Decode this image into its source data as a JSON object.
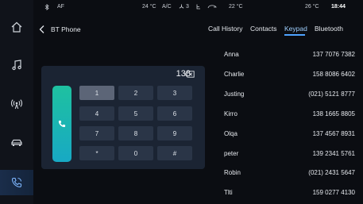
{
  "status": {
    "bt_icon": "bluetooth-icon",
    "af": "AF",
    "temp_left": "24 °C",
    "ac": "A/C",
    "fan": "3",
    "temp_center": "22 °C",
    "temp_right": "26 °C",
    "time": "18:44"
  },
  "header": {
    "back_icon": "chevron-left-icon",
    "title": "BT Phone"
  },
  "tabs": [
    {
      "label": "Call History",
      "active": false
    },
    {
      "label": "Contacts",
      "active": false
    },
    {
      "label": "Keypad",
      "active": true
    },
    {
      "label": "Bluetooth",
      "active": false
    }
  ],
  "sidebar": {
    "items": [
      {
        "icon": "home-icon"
      },
      {
        "icon": "music-note-icon"
      },
      {
        "icon": "radio-icon"
      },
      {
        "icon": "car-icon"
      },
      {
        "icon": "phone-icon",
        "active": true
      }
    ]
  },
  "keypad": {
    "display": "138",
    "delete_icon": "backspace-icon",
    "call_icon": "phone-icon",
    "keys": [
      "1",
      "2",
      "3",
      "4",
      "5",
      "6",
      "7",
      "8",
      "9",
      "*",
      "0",
      "#"
    ],
    "pressed_key": "1"
  },
  "contacts": [
    {
      "name": "Anna",
      "number": "137 7076 7382"
    },
    {
      "name": "Charlie",
      "number": "158 8086 6402"
    },
    {
      "name": "Justing",
      "number": "(021) 5121 8777"
    },
    {
      "name": "Kirro",
      "number": "138 1665 8805"
    },
    {
      "name": "Olqa",
      "number": "137 4567 8931"
    },
    {
      "name": "peter",
      "number": "139 2341 5761"
    },
    {
      "name": "Robin",
      "number": "(021) 2431 5647"
    },
    {
      "name": "Tlti",
      "number": "159 0277 4130"
    }
  ],
  "colors": {
    "accent": "#4ea3ff",
    "call_gradient_top": "#1ec1a0",
    "call_gradient_bottom": "#18a9c4",
    "background": "#0b0d12"
  }
}
